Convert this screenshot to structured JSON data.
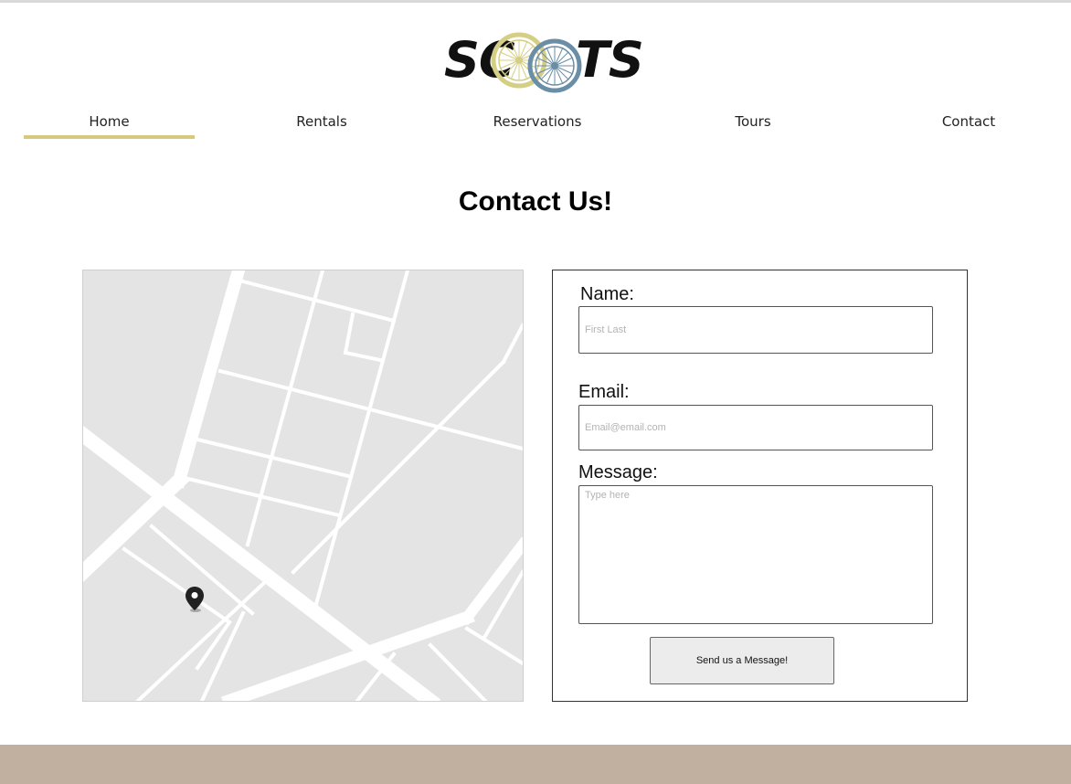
{
  "brand": {
    "logo_left": "SC",
    "logo_right": "TS",
    "colors": {
      "wheel_a": "#d5cf86",
      "wheel_b": "#6a8ea6",
      "accent": "#d4c97f",
      "footer": "#c1b09f"
    }
  },
  "nav": {
    "items": [
      {
        "label": "Home",
        "active": true
      },
      {
        "label": "Rentals",
        "active": false
      },
      {
        "label": "Reservations",
        "active": false
      },
      {
        "label": "Tours",
        "active": false
      },
      {
        "label": "Contact",
        "active": false
      }
    ]
  },
  "page": {
    "title": "Contact Us!"
  },
  "map": {
    "marker_icon": "map-pin-icon"
  },
  "form": {
    "name_label": "Name:",
    "name_placeholder": "First Last",
    "email_label": "Email:",
    "email_placeholder": "Email@email.com",
    "message_label": "Message:",
    "message_placeholder": "Type here",
    "submit_label": "Send us a Message!"
  }
}
